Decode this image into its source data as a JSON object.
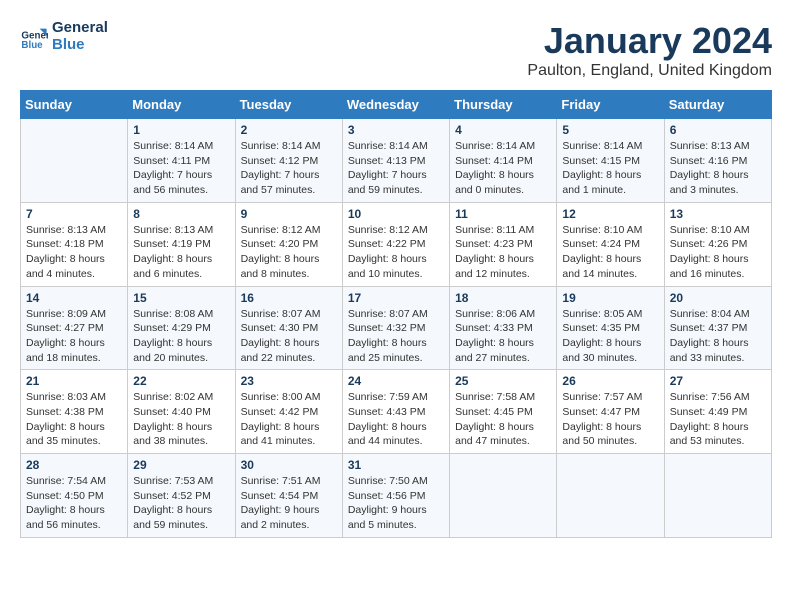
{
  "header": {
    "logo_line1": "General",
    "logo_line2": "Blue",
    "month": "January 2024",
    "location": "Paulton, England, United Kingdom"
  },
  "days_of_week": [
    "Sunday",
    "Monday",
    "Tuesday",
    "Wednesday",
    "Thursday",
    "Friday",
    "Saturday"
  ],
  "weeks": [
    [
      {
        "day": "",
        "info": ""
      },
      {
        "day": "1",
        "info": "Sunrise: 8:14 AM\nSunset: 4:11 PM\nDaylight: 7 hours\nand 56 minutes."
      },
      {
        "day": "2",
        "info": "Sunrise: 8:14 AM\nSunset: 4:12 PM\nDaylight: 7 hours\nand 57 minutes."
      },
      {
        "day": "3",
        "info": "Sunrise: 8:14 AM\nSunset: 4:13 PM\nDaylight: 7 hours\nand 59 minutes."
      },
      {
        "day": "4",
        "info": "Sunrise: 8:14 AM\nSunset: 4:14 PM\nDaylight: 8 hours\nand 0 minutes."
      },
      {
        "day": "5",
        "info": "Sunrise: 8:14 AM\nSunset: 4:15 PM\nDaylight: 8 hours\nand 1 minute."
      },
      {
        "day": "6",
        "info": "Sunrise: 8:13 AM\nSunset: 4:16 PM\nDaylight: 8 hours\nand 3 minutes."
      }
    ],
    [
      {
        "day": "7",
        "info": "Sunrise: 8:13 AM\nSunset: 4:18 PM\nDaylight: 8 hours\nand 4 minutes."
      },
      {
        "day": "8",
        "info": "Sunrise: 8:13 AM\nSunset: 4:19 PM\nDaylight: 8 hours\nand 6 minutes."
      },
      {
        "day": "9",
        "info": "Sunrise: 8:12 AM\nSunset: 4:20 PM\nDaylight: 8 hours\nand 8 minutes."
      },
      {
        "day": "10",
        "info": "Sunrise: 8:12 AM\nSunset: 4:22 PM\nDaylight: 8 hours\nand 10 minutes."
      },
      {
        "day": "11",
        "info": "Sunrise: 8:11 AM\nSunset: 4:23 PM\nDaylight: 8 hours\nand 12 minutes."
      },
      {
        "day": "12",
        "info": "Sunrise: 8:10 AM\nSunset: 4:24 PM\nDaylight: 8 hours\nand 14 minutes."
      },
      {
        "day": "13",
        "info": "Sunrise: 8:10 AM\nSunset: 4:26 PM\nDaylight: 8 hours\nand 16 minutes."
      }
    ],
    [
      {
        "day": "14",
        "info": "Sunrise: 8:09 AM\nSunset: 4:27 PM\nDaylight: 8 hours\nand 18 minutes."
      },
      {
        "day": "15",
        "info": "Sunrise: 8:08 AM\nSunset: 4:29 PM\nDaylight: 8 hours\nand 20 minutes."
      },
      {
        "day": "16",
        "info": "Sunrise: 8:07 AM\nSunset: 4:30 PM\nDaylight: 8 hours\nand 22 minutes."
      },
      {
        "day": "17",
        "info": "Sunrise: 8:07 AM\nSunset: 4:32 PM\nDaylight: 8 hours\nand 25 minutes."
      },
      {
        "day": "18",
        "info": "Sunrise: 8:06 AM\nSunset: 4:33 PM\nDaylight: 8 hours\nand 27 minutes."
      },
      {
        "day": "19",
        "info": "Sunrise: 8:05 AM\nSunset: 4:35 PM\nDaylight: 8 hours\nand 30 minutes."
      },
      {
        "day": "20",
        "info": "Sunrise: 8:04 AM\nSunset: 4:37 PM\nDaylight: 8 hours\nand 33 minutes."
      }
    ],
    [
      {
        "day": "21",
        "info": "Sunrise: 8:03 AM\nSunset: 4:38 PM\nDaylight: 8 hours\nand 35 minutes."
      },
      {
        "day": "22",
        "info": "Sunrise: 8:02 AM\nSunset: 4:40 PM\nDaylight: 8 hours\nand 38 minutes."
      },
      {
        "day": "23",
        "info": "Sunrise: 8:00 AM\nSunset: 4:42 PM\nDaylight: 8 hours\nand 41 minutes."
      },
      {
        "day": "24",
        "info": "Sunrise: 7:59 AM\nSunset: 4:43 PM\nDaylight: 8 hours\nand 44 minutes."
      },
      {
        "day": "25",
        "info": "Sunrise: 7:58 AM\nSunset: 4:45 PM\nDaylight: 8 hours\nand 47 minutes."
      },
      {
        "day": "26",
        "info": "Sunrise: 7:57 AM\nSunset: 4:47 PM\nDaylight: 8 hours\nand 50 minutes."
      },
      {
        "day": "27",
        "info": "Sunrise: 7:56 AM\nSunset: 4:49 PM\nDaylight: 8 hours\nand 53 minutes."
      }
    ],
    [
      {
        "day": "28",
        "info": "Sunrise: 7:54 AM\nSunset: 4:50 PM\nDaylight: 8 hours\nand 56 minutes."
      },
      {
        "day": "29",
        "info": "Sunrise: 7:53 AM\nSunset: 4:52 PM\nDaylight: 8 hours\nand 59 minutes."
      },
      {
        "day": "30",
        "info": "Sunrise: 7:51 AM\nSunset: 4:54 PM\nDaylight: 9 hours\nand 2 minutes."
      },
      {
        "day": "31",
        "info": "Sunrise: 7:50 AM\nSunset: 4:56 PM\nDaylight: 9 hours\nand 5 minutes."
      },
      {
        "day": "",
        "info": ""
      },
      {
        "day": "",
        "info": ""
      },
      {
        "day": "",
        "info": ""
      }
    ]
  ]
}
